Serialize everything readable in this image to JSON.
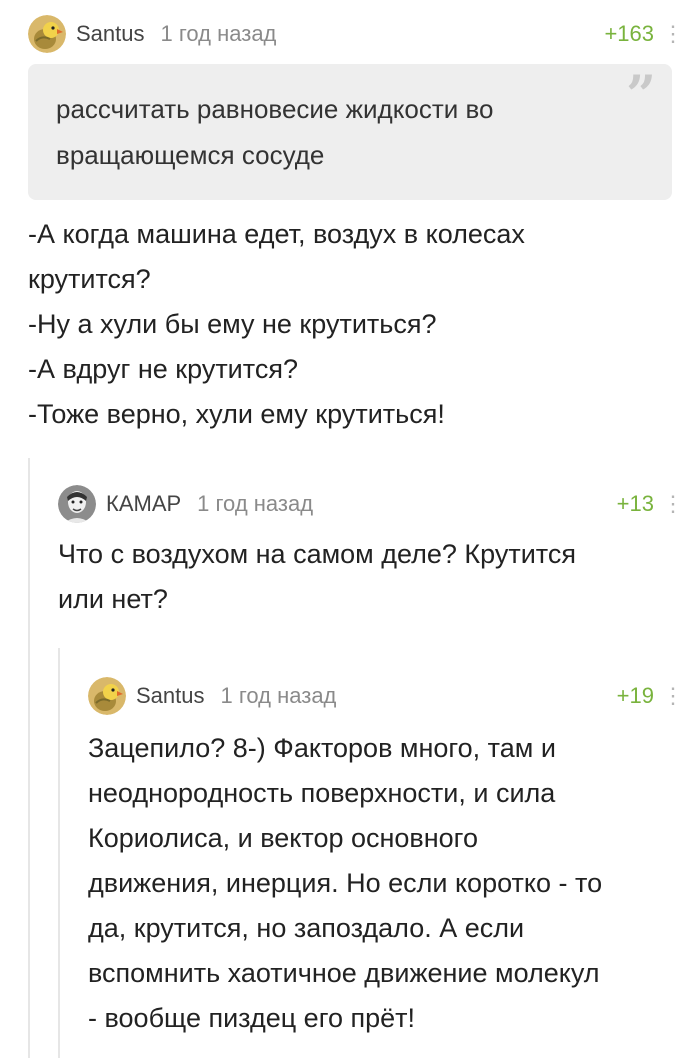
{
  "comments": [
    {
      "author": "Santus",
      "time": "1 год назад",
      "rating": "+163",
      "avatar": "parrot-avatar",
      "quote_lines": [
        "рассчитать равновесие жидкости во",
        "вращающемся сосуде"
      ],
      "body_lines": [
        "-А когда машина едет, воздух в колесах",
        "крутится?",
        "-Ну а хули бы ему не крутиться?",
        "-А вдруг не крутится?",
        "-Тоже верно, хули ему крутиться!"
      ]
    },
    {
      "author": "КАМАР",
      "time": "1 год назад",
      "rating": "+13",
      "avatar": "portrait-avatar",
      "body_lines": [
        "Что с воздухом на самом деле? Крутится",
        "или нет?"
      ]
    },
    {
      "author": "Santus",
      "time": "1 год назад",
      "rating": "+19",
      "avatar": "parrot-avatar",
      "body_lines": [
        "Зацепило? 8-) Факторов много, там и",
        "неоднородность поверхности, и сила",
        "Кориолиса, и вектор основного",
        "движения, инерция. Но если коротко - то",
        "да, крутится, но запоздало. А если",
        "вспомнить хаотичное движение молекул",
        "- вообще пиздец его прёт!"
      ]
    }
  ],
  "icons": {
    "more": "more-vertical-icon",
    "quote": "quote-icon"
  },
  "colors": {
    "rating": "#79b33d",
    "quote_bg": "#eeeeee",
    "meta": "#8a8a8a"
  }
}
